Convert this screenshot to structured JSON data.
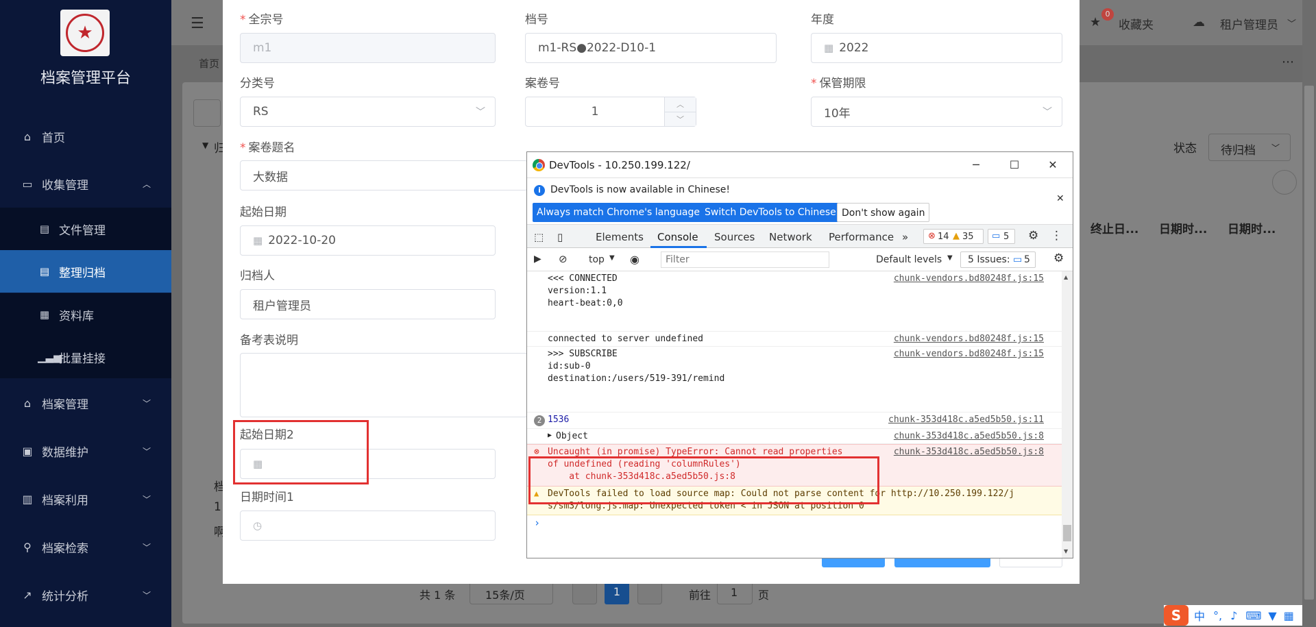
{
  "sidebar": {
    "app_title": "档案管理平台",
    "items": [
      {
        "label": "首页",
        "icon": "home-icon"
      },
      {
        "label": "收集管理",
        "icon": "inbox-icon"
      },
      {
        "label": "档案管理",
        "icon": "bank-icon"
      },
      {
        "label": "数据维护",
        "icon": "database-icon"
      },
      {
        "label": "档案利用",
        "icon": "clipboard-icon"
      },
      {
        "label": "档案检索",
        "icon": "search-icon"
      },
      {
        "label": "统计分析",
        "icon": "chart-icon"
      }
    ],
    "sub_items": [
      {
        "label": "文件管理",
        "icon": "file-icon"
      },
      {
        "label": "整理归档",
        "icon": "document-icon"
      },
      {
        "label": "资料库",
        "icon": "calendar-icon"
      },
      {
        "label": "批量挂接",
        "icon": "bar-chart-icon"
      }
    ]
  },
  "header": {
    "badge_count": "0",
    "favorites": "收藏夹",
    "user": "租户管理员",
    "breadcrumb_home": "首页"
  },
  "background_page": {
    "status_label": "状态",
    "status_value": "待归档",
    "col_headers": [
      "终止日...",
      "日期时...",
      "日期时..."
    ],
    "tree_fragments": [
      "归",
      "档",
      "1",
      "啊"
    ],
    "pagination": {
      "total": "共 1 条",
      "page_size": "15条/页",
      "current_page": "1",
      "goto_label": "前往",
      "goto_value": "1",
      "page_suffix": "页"
    }
  },
  "form": {
    "fonds_no": {
      "label": "全宗号",
      "value": "m1"
    },
    "archive_no": {
      "label": "档号",
      "value": "m1-RS●2022-D10-1"
    },
    "year": {
      "label": "年度",
      "value": "2022"
    },
    "category": {
      "label": "分类号",
      "value": "RS"
    },
    "volume_no": {
      "label": "案卷号",
      "value": "1"
    },
    "retention": {
      "label": "保管期限",
      "value": "10年"
    },
    "volume_title": {
      "label": "案卷题名",
      "value": "大数据"
    },
    "start_date": {
      "label": "起始日期",
      "value": "2022-10-20"
    },
    "archiver": {
      "label": "归档人",
      "value": "租户管理员"
    },
    "remark": {
      "label": "备考表说明",
      "value": ""
    },
    "start_date2": {
      "label": "起始日期2",
      "value": ""
    },
    "datetime1": {
      "label": "日期时间1",
      "value": ""
    }
  },
  "devtools": {
    "title": "DevTools - 10.250.199.122/",
    "info_text": "DevTools is now available in Chinese!",
    "btn_match": "Always match Chrome's language",
    "btn_switch": "Switch DevTools to Chinese",
    "btn_dont_show": "Don't show again",
    "tabs": [
      "Elements",
      "Console",
      "Sources",
      "Network",
      "Performance"
    ],
    "active_tab": "Console",
    "error_count": "14",
    "warning_count": "35",
    "message_count": "5",
    "context": "top",
    "filter_placeholder": "Filter",
    "levels": "Default levels",
    "issues_label": "5 Issues:",
    "issues_count": "5",
    "console_lines": [
      {
        "text": "<<< CONNECTED\nversion:1.1\nheart-beat:0,0",
        "source": "chunk-vendors.bd80248f.js:15"
      },
      {
        "text": "connected to server undefined",
        "source": "chunk-vendors.bd80248f.js:15"
      },
      {
        "text": ">>> SUBSCRIBE\nid:sub-0\ndestination:/users/519-391/remind",
        "source": "chunk-vendors.bd80248f.js:15"
      },
      {
        "text": "1536",
        "repeat": "2",
        "source": "chunk-353d418c.a5ed5b50.js:11"
      },
      {
        "text": "Object",
        "source": "chunk-353d418c.a5ed5b50.js:8"
      },
      {
        "text": "Uncaught (in promise) TypeError: Cannot read properties\nof undefined (reading 'columnRules')\n    at chunk-353d418c.a5ed5b50.js:8",
        "source": "chunk-353d418c.a5ed5b50.js:8"
      },
      {
        "text": "DevTools failed to load source map: Could not parse content for http://10.250.199.122/j\ns/sm3/long.js.map: Unexpected token < in JSON at position 0",
        "source": ""
      }
    ]
  },
  "ime": {
    "label": "中"
  }
}
